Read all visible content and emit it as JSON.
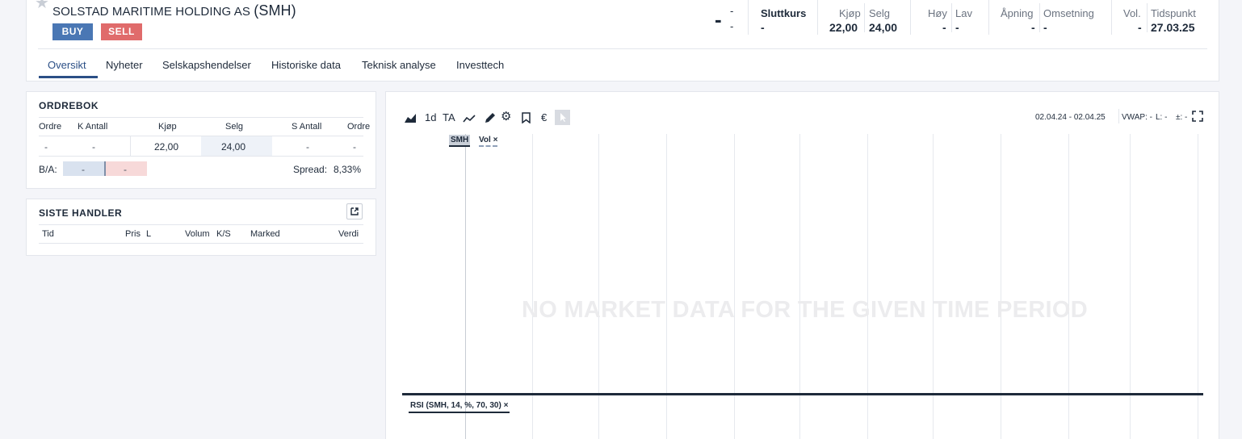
{
  "header": {
    "company_name": "SOLSTAD MARITIME HOLDING AS",
    "ticker": "(SMH)",
    "buy_label": "BUY",
    "sell_label": "SELL",
    "last_price": "-",
    "change_abs": "-",
    "change_pct": "-",
    "quotes": {
      "close": {
        "label": "Sluttkurs",
        "value": "-"
      },
      "bid": {
        "label": "Kjøp",
        "value": "22,00"
      },
      "ask": {
        "label": "Selg",
        "value": "24,00"
      },
      "high": {
        "label": "Høy",
        "value": "-"
      },
      "low": {
        "label": "Lav",
        "value": "-"
      },
      "open": {
        "label": "Åpning",
        "value": "-"
      },
      "turnover": {
        "label": "Omsetning",
        "value": "-"
      },
      "volume": {
        "label": "Vol.",
        "value": "-"
      },
      "time": {
        "label": "Tidspunkt",
        "value": "27.03.25"
      }
    },
    "tabs": [
      "Oversikt",
      "Nyheter",
      "Selskapshendelser",
      "Historiske data",
      "Teknisk analyse",
      "Investtech"
    ]
  },
  "orderbook": {
    "title": "ORDREBOK",
    "columns": [
      "Ordre",
      "K Antall",
      "Kjøp",
      "Selg",
      "S Antall",
      "Ordre"
    ],
    "row": [
      "-",
      "-",
      "22,00",
      "24,00",
      "-",
      "-"
    ],
    "ba_label": "B/A:",
    "ba_bid": "-",
    "ba_ask": "-",
    "spread_label": "Spread:",
    "spread_value": "8,33%"
  },
  "trades": {
    "title": "SISTE HANDLER",
    "columns": [
      "Tid",
      "Pris",
      "L",
      "Volum",
      "K/S",
      "Marked",
      "Verdi"
    ]
  },
  "chart": {
    "interval": "1d",
    "ta_label": "TA",
    "currency_symbol": "€",
    "date_range": "02.04.24 - 02.04.25",
    "vwap": "VWAP: -",
    "l_value": "L: -",
    "pm_value": "±: -",
    "series_tag": "SMH",
    "vol_tag": "Vol",
    "no_data": "NO MARKET DATA FOR THE GIVEN TIME PERIOD",
    "rsi_tag": "RSI (SMH, 14, %, 70, 30)",
    "close_mark": "×"
  },
  "colors": {
    "accent": "#2b4f86",
    "buy": "#4a77b4",
    "sell": "#e06b6b"
  },
  "icons": [
    "star-icon",
    "area-chart-icon",
    "line-chart-icon",
    "pencil-icon",
    "gear-icon",
    "bookmark-icon",
    "cursor-icon",
    "fullscreen-icon",
    "external-link-icon"
  ]
}
